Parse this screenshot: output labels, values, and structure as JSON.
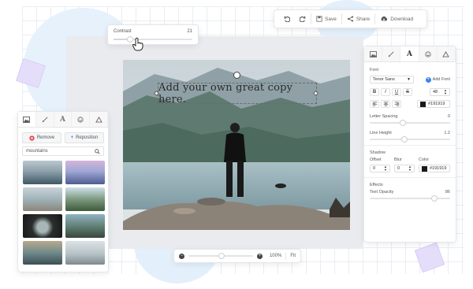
{
  "toolbar": {
    "undo_icon": "undo-icon",
    "redo_icon": "redo-icon",
    "save_label": "Save",
    "share_label": "Share",
    "download_label": "Download"
  },
  "contrast": {
    "label": "Contrast",
    "value": "21",
    "level": 0.21
  },
  "canvas": {
    "headline": "Add your own great copy here."
  },
  "left_panel": {
    "tabs": [
      "image-icon",
      "brush-icon",
      "A",
      "emoji-icon",
      "triangle-icon"
    ],
    "remove_label": "Remove",
    "reposition_label": "Reposition",
    "search_value": "mountains"
  },
  "right_panel": {
    "tabs": [
      "image-icon",
      "brush-icon",
      "A",
      "emoji-icon",
      "triangle-icon"
    ],
    "font_heading": "Font",
    "font_value": "Tenor Sans",
    "add_font_label": "Add Font",
    "style_buttons": [
      "B",
      "I",
      "U",
      "S"
    ],
    "font_size": "48",
    "color_hex": "#191919",
    "letter_spacing_label": "Letter Spacing",
    "letter_spacing_value": "0",
    "line_height_label": "Line Height",
    "line_height_value": "1.2",
    "shadow_heading": "Shadow",
    "offset_label": "Offset",
    "offset_value": "0",
    "blur_label": "Blur",
    "blur_value": "0",
    "color_label": "Color",
    "shadow_color_hex": "#191919",
    "effects_heading": "Effects",
    "text_opacity_label": "Text Opacity",
    "text_opacity_value": "86"
  },
  "zoom": {
    "percent": "100%",
    "fit_label": "Fit"
  },
  "colors": {
    "accent": "#3b82f6",
    "remove_red": "#e04848"
  }
}
